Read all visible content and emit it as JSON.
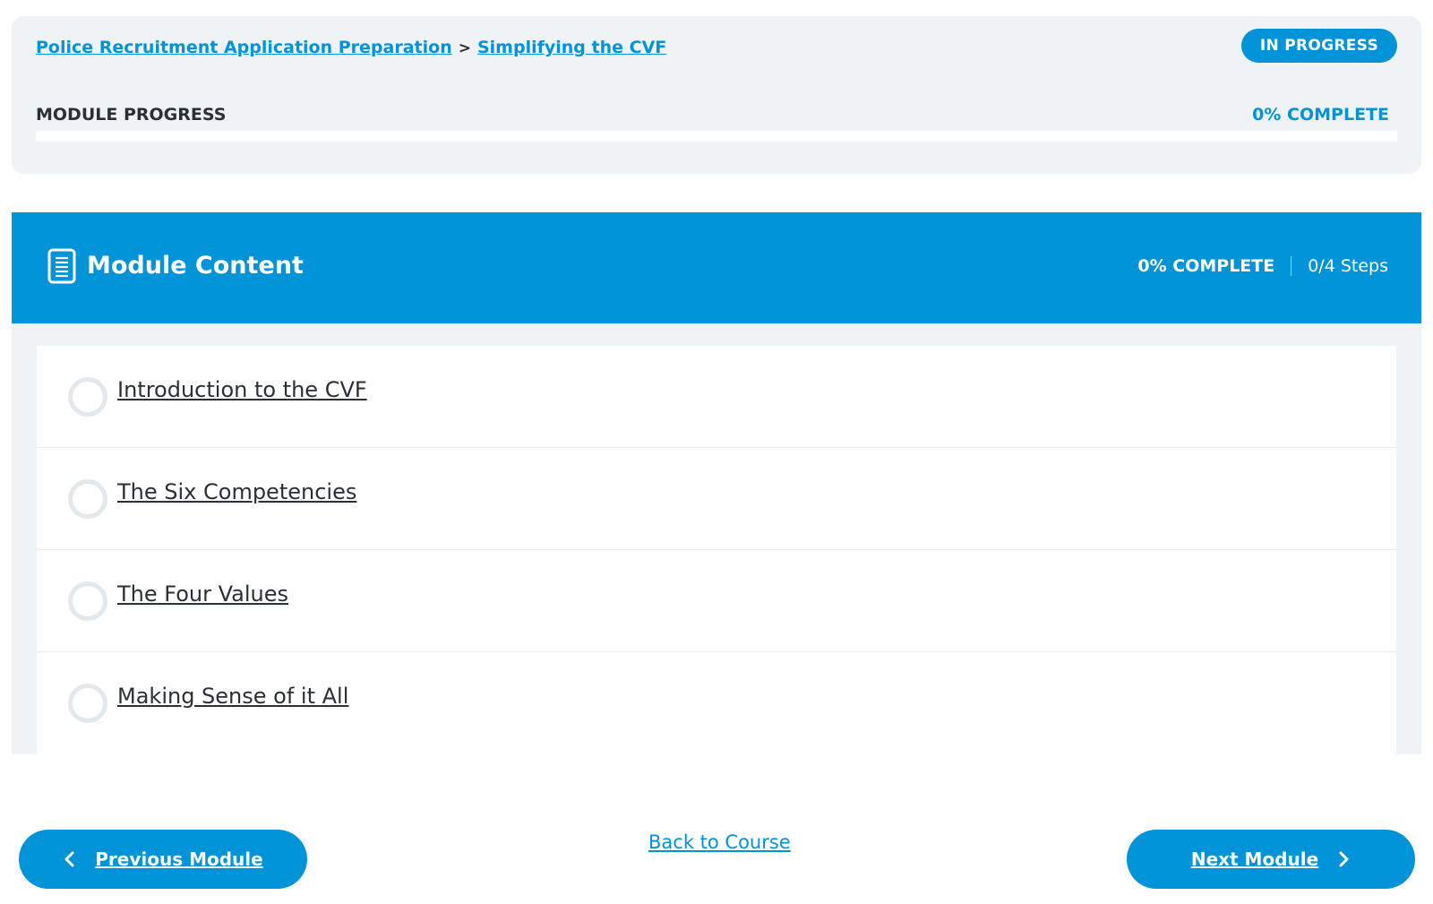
{
  "breadcrumb": {
    "course_title": "Police Recruitment Application Preparation",
    "separator": ">",
    "module_title": "Simplifying the CVF"
  },
  "status_badge": "IN PROGRESS",
  "module_progress": {
    "label": "MODULE PROGRESS",
    "percent_label": "0% COMPLETE",
    "percent_value": 0
  },
  "content_header": {
    "icon": "document-icon",
    "title": "Module Content",
    "percent_label": "0% COMPLETE",
    "steps_label": "0/4 Steps"
  },
  "steps": [
    {
      "title": "Introduction to the CVF",
      "completed": false
    },
    {
      "title": "The Six Competencies",
      "completed": false
    },
    {
      "title": "The Four Values",
      "completed": false
    },
    {
      "title": "Making Sense of it All",
      "completed": false
    }
  ],
  "footer": {
    "previous_label": "Previous Module",
    "back_label": "Back to Course",
    "next_label": "Next Module"
  },
  "colors": {
    "accent": "#0193d7",
    "panel_background": "#eff3f6",
    "text": "#2b2f36",
    "incomplete_circle": "#e3e8ec"
  }
}
